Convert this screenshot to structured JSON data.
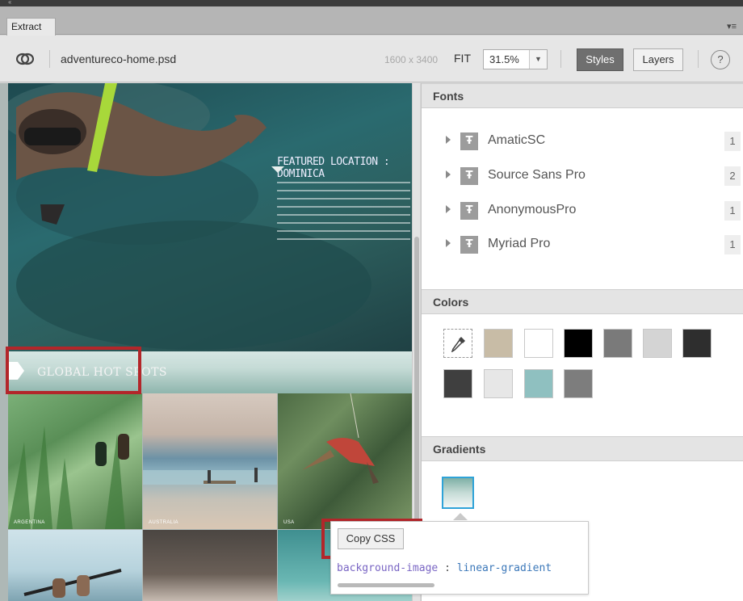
{
  "window": {
    "tab_label": "Extract"
  },
  "toolbar": {
    "filename": "adventureco-home.psd",
    "dimensions": "1600 x 3400",
    "fit_label": "FIT",
    "zoom_value": "31.5%",
    "styles_label": "Styles",
    "layers_label": "Layers",
    "help_label": "?"
  },
  "canvas": {
    "featured_title": "FEATURED LOCATION : DOMINICA",
    "section_label": "GLOBAL HOT SPOTS",
    "tiles": [
      {
        "caption": "ARGENTINA"
      },
      {
        "caption": "AUSTRALIA"
      },
      {
        "caption": "USA"
      }
    ]
  },
  "panel": {
    "fonts_header": "Fonts",
    "fonts": [
      {
        "name": "AmaticSC",
        "count": "1"
      },
      {
        "name": "Source Sans Pro",
        "count": "2"
      },
      {
        "name": "AnonymousPro",
        "count": "1"
      },
      {
        "name": "Myriad Pro",
        "count": "1"
      }
    ],
    "colors_header": "Colors",
    "colors": [
      "#c8bca6",
      "#ffffff",
      "#000000",
      "#7a7a7a",
      "#d4d4d4",
      "#2e2e2e",
      "#3f3f3f",
      "#e7e7e7",
      "#8fc0c0",
      "#7d7d7d"
    ],
    "gradients_header": "Gradients"
  },
  "popover": {
    "copy_label": "Copy CSS",
    "css_property": "background-image",
    "css_colon": ":",
    "css_value": "linear-gradient"
  },
  "accent_colors": {
    "highlight_red": "#b3262a",
    "selected_blue": "#2fa3d8",
    "active_button": "#6f6f6f"
  }
}
